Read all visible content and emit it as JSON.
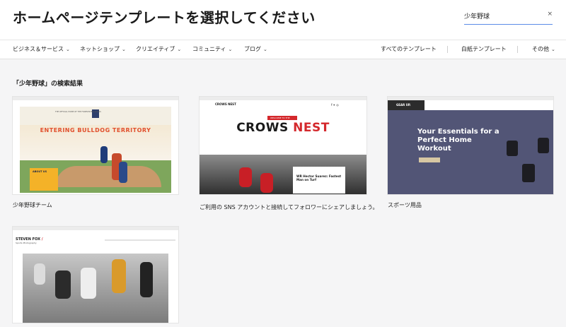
{
  "header": {
    "title": "ホームページテンプレートを選択してください",
    "search": {
      "value": "少年野球",
      "clear_icon": "×"
    }
  },
  "nav": {
    "left": [
      {
        "label": "ビジネス＆サービス"
      },
      {
        "label": "ネットショップ"
      },
      {
        "label": "クリエイティブ"
      },
      {
        "label": "コミュニティ"
      },
      {
        "label": "ブログ"
      }
    ],
    "right": [
      {
        "label": "すべてのテンプレート"
      },
      {
        "label": "白紙テンプレート"
      },
      {
        "label": "その他",
        "has_dropdown": true
      }
    ]
  },
  "results_heading": "「少年野球」の検索結果",
  "templates": [
    {
      "label": "少年野球チーム",
      "preview": {
        "top_text": "THE OFFICIAL HOME OF THE FOREVER BULLDOGS",
        "hero": "ENTERING BULLDOG TERRITORY",
        "box": "ABOUT US"
      }
    },
    {
      "label": "ご利用の SNS アカウントと接続してフォロワーにシェアしましょう。",
      "preview": {
        "logo": "CROWS NEST",
        "pill": "WELCOME TO THE",
        "title_a": "CROWS ",
        "title_b": "NEST",
        "post": "WR Hector Suarez: Fastest Man on Turf"
      }
    },
    {
      "label": "スポーツ用品",
      "preview": {
        "logo": "GEAR UP.",
        "title": "Your Essentials for a Perfect Home Workout"
      }
    },
    {
      "label": "",
      "preview": {
        "logo": "STEVEN FOX",
        "logo_mark": "/",
        "sub": "Sports Photography"
      }
    }
  ],
  "colors": {
    "accent_blue": "#5b8ce8",
    "bulldog_orange": "#e14f2c",
    "crows_red": "#d4282c",
    "gear_purple": "#525576"
  }
}
